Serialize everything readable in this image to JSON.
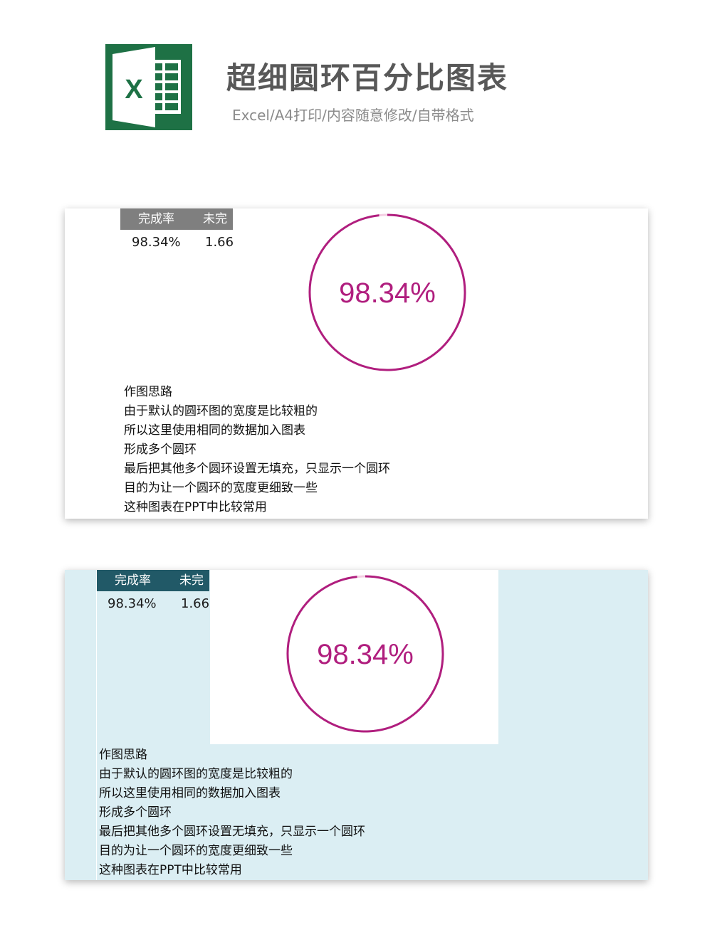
{
  "header": {
    "logo_letter": "X",
    "title": "超细圆环百分比图表",
    "subtitle": "Excel/A4打印/内容随意修改/自带格式"
  },
  "colors": {
    "excel_green": "#1e7145",
    "ring": "#b01e7e",
    "ring_gap": "#f4cfe3",
    "header_gray": "#7f7f7f",
    "header_teal": "#215967",
    "panel2_bg": "#dbeef3"
  },
  "panels": [
    {
      "table": {
        "headers": [
          "完成率",
          "未完"
        ],
        "values": [
          "98.34%",
          "1.66"
        ]
      },
      "chart_label": "98.34%",
      "notes": [
        "作图思路",
        "由于默认的圆环图的宽度是比较粗的",
        "所以这里使用相同的数据加入图表",
        "形成多个圆环",
        "最后把其他多个圆环设置无填充，只显示一个圆环",
        "目的为让一个圆环的宽度更细致一些",
        "这种图表在PPT中比较常用"
      ]
    },
    {
      "table": {
        "headers": [
          "完成率",
          "未完"
        ],
        "values": [
          "98.34%",
          "1.66"
        ]
      },
      "chart_label": "98.34%",
      "notes": [
        "作图思路",
        "由于默认的圆环图的宽度是比较粗的",
        "所以这里使用相同的数据加入图表",
        "形成多个圆环",
        "最后把其他多个圆环设置无填充，只显示一个圆环",
        "目的为让一个圆环的宽度更细致一些",
        "这种图表在PPT中比较常用"
      ]
    }
  ],
  "chart_data": [
    {
      "type": "pie",
      "categories": [
        "完成率",
        "未完"
      ],
      "values": [
        98.34,
        1.66
      ],
      "title": ""
    },
    {
      "type": "pie",
      "categories": [
        "完成率",
        "未完"
      ],
      "values": [
        98.34,
        1.66
      ],
      "title": ""
    }
  ]
}
